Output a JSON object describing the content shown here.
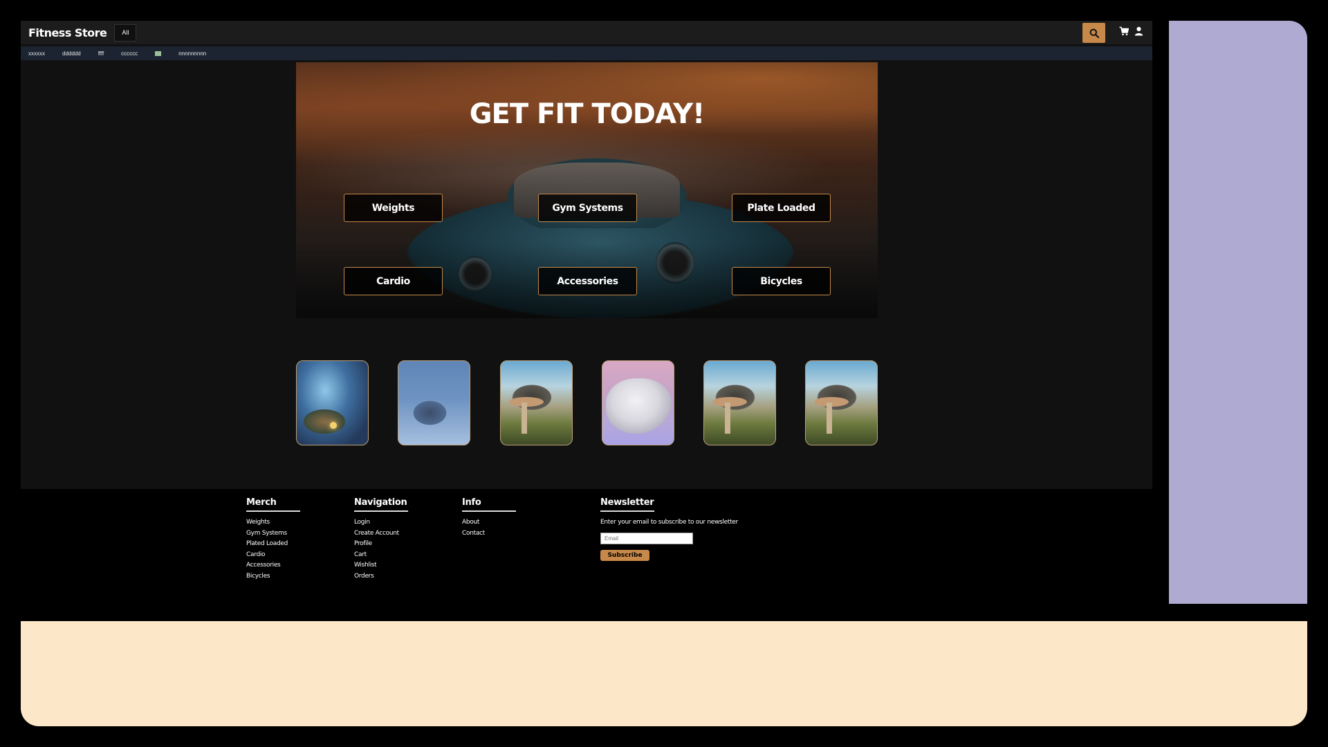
{
  "app": {
    "brand": "Fitness Store",
    "category_select": "All"
  },
  "subnav": {
    "items": [
      "xxxxxx",
      "dddddd",
      "ffff",
      "cccccc",
      "",
      "nnnnnnnnn"
    ]
  },
  "hero": {
    "title": "GET FIT TODAY!",
    "buttons": [
      "Weights",
      "Gym Systems",
      "Plate Loaded",
      "Cardio",
      "Accessories",
      "Bicycles"
    ]
  },
  "thumbnails": [
    {
      "name": "fantasy-castle-night"
    },
    {
      "name": "snowy-cabin"
    },
    {
      "name": "mushroom-creature-1"
    },
    {
      "name": "white-fluffy-creature"
    },
    {
      "name": "mushroom-creature-2"
    },
    {
      "name": "mushroom-creature-3"
    }
  ],
  "footer": {
    "merch": {
      "title": "Merch",
      "items": [
        "Weights",
        "Gym Systems",
        "Plated Loaded",
        "Cardio",
        "Accessories",
        "Bicycles"
      ]
    },
    "navigation": {
      "title": "Navigation",
      "items": [
        "Login",
        "Create Account",
        "Profile",
        "Cart",
        "Wishlist",
        "Orders"
      ]
    },
    "info": {
      "title": "Info",
      "items": [
        "About",
        "Contact"
      ]
    },
    "newsletter": {
      "title": "Newsletter",
      "text": "Enter your email to subscribe to our newsletter",
      "placeholder": "Email",
      "button": "Subscribe"
    }
  },
  "colors": {
    "accent": "#c6894a",
    "side_panel": "#aeaad2",
    "bottom_panel": "#fde7c9"
  },
  "icons": {
    "search": "search-icon",
    "cart": "cart-icon",
    "user": "user-icon"
  }
}
